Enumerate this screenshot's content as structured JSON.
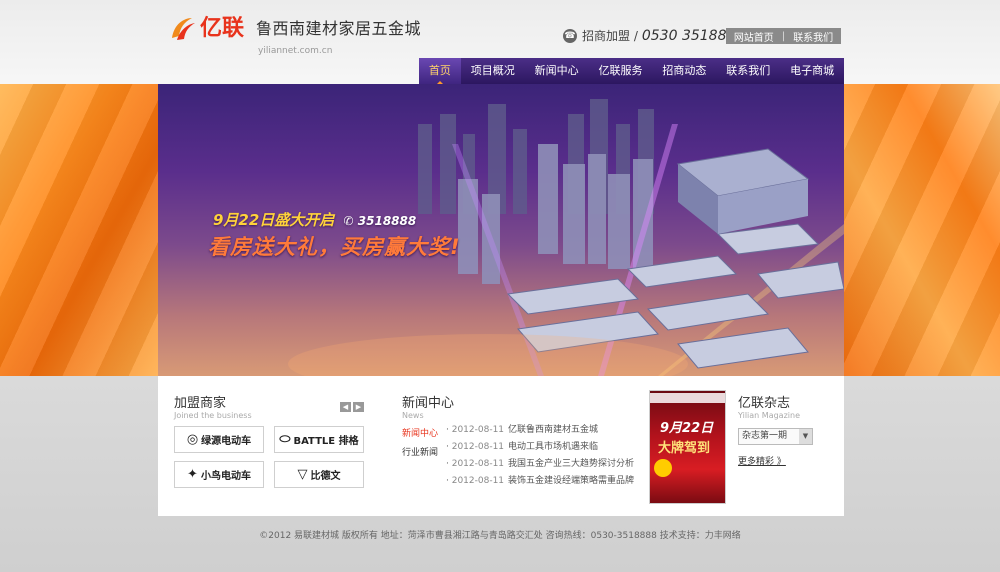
{
  "header": {
    "logo_cn": "亿联",
    "title": "鲁西南建材家居五金城",
    "domain": "yiliannet.com.cn",
    "hotline_label": "招商加盟 /",
    "hotline_number": "0530 3518888",
    "links": [
      "网站首页",
      "联系我们"
    ]
  },
  "nav": {
    "items": [
      "首页",
      "项目概况",
      "新闻中心",
      "亿联服务",
      "招商动态",
      "联系我们",
      "电子商城"
    ],
    "active": 0
  },
  "banner": {
    "headline": "9月22日盛大开启",
    "tel": "3518888",
    "slogan": "看房送大礼，买房赢大奖!"
  },
  "merchants": {
    "title": "加盟商家",
    "subtitle": "Joined the business",
    "brands": [
      {
        "name": "绿源电动车",
        "icon": "circle-logo"
      },
      {
        "name": "BATTLE 排格",
        "icon": "oval-logo"
      },
      {
        "name": "小鸟电动车",
        "icon": "bird-logo"
      },
      {
        "name": "比德文",
        "icon": "v-logo"
      }
    ]
  },
  "news": {
    "title": "新闻中心",
    "subtitle": "News",
    "tabs": [
      "新闻中心",
      "行业新闻"
    ],
    "items": [
      {
        "date": "2012-08-11",
        "text": "亿联鲁西南建材五金城"
      },
      {
        "date": "2012-08-11",
        "text": "电动工具市场机遇来临"
      },
      {
        "date": "2012-08-11",
        "text": "我国五金产业三大趋势探讨分析"
      },
      {
        "date": "2012-08-11",
        "text": "装饰五金建设经端策略需重品牌"
      }
    ]
  },
  "magazine": {
    "title": "亿联杂志",
    "subtitle": "Yilian Magazine",
    "select_value": "杂志第一期",
    "more": "更多精彩 》",
    "cover_line1": "9月22日",
    "cover_line2": "大牌驾到"
  },
  "footer": {
    "text": "©2012  易联建材城  版权所有  地址：菏泽市曹县湘江路与青岛路交汇处  咨询热线：0530-3518888  技术支持：力丰网络"
  }
}
